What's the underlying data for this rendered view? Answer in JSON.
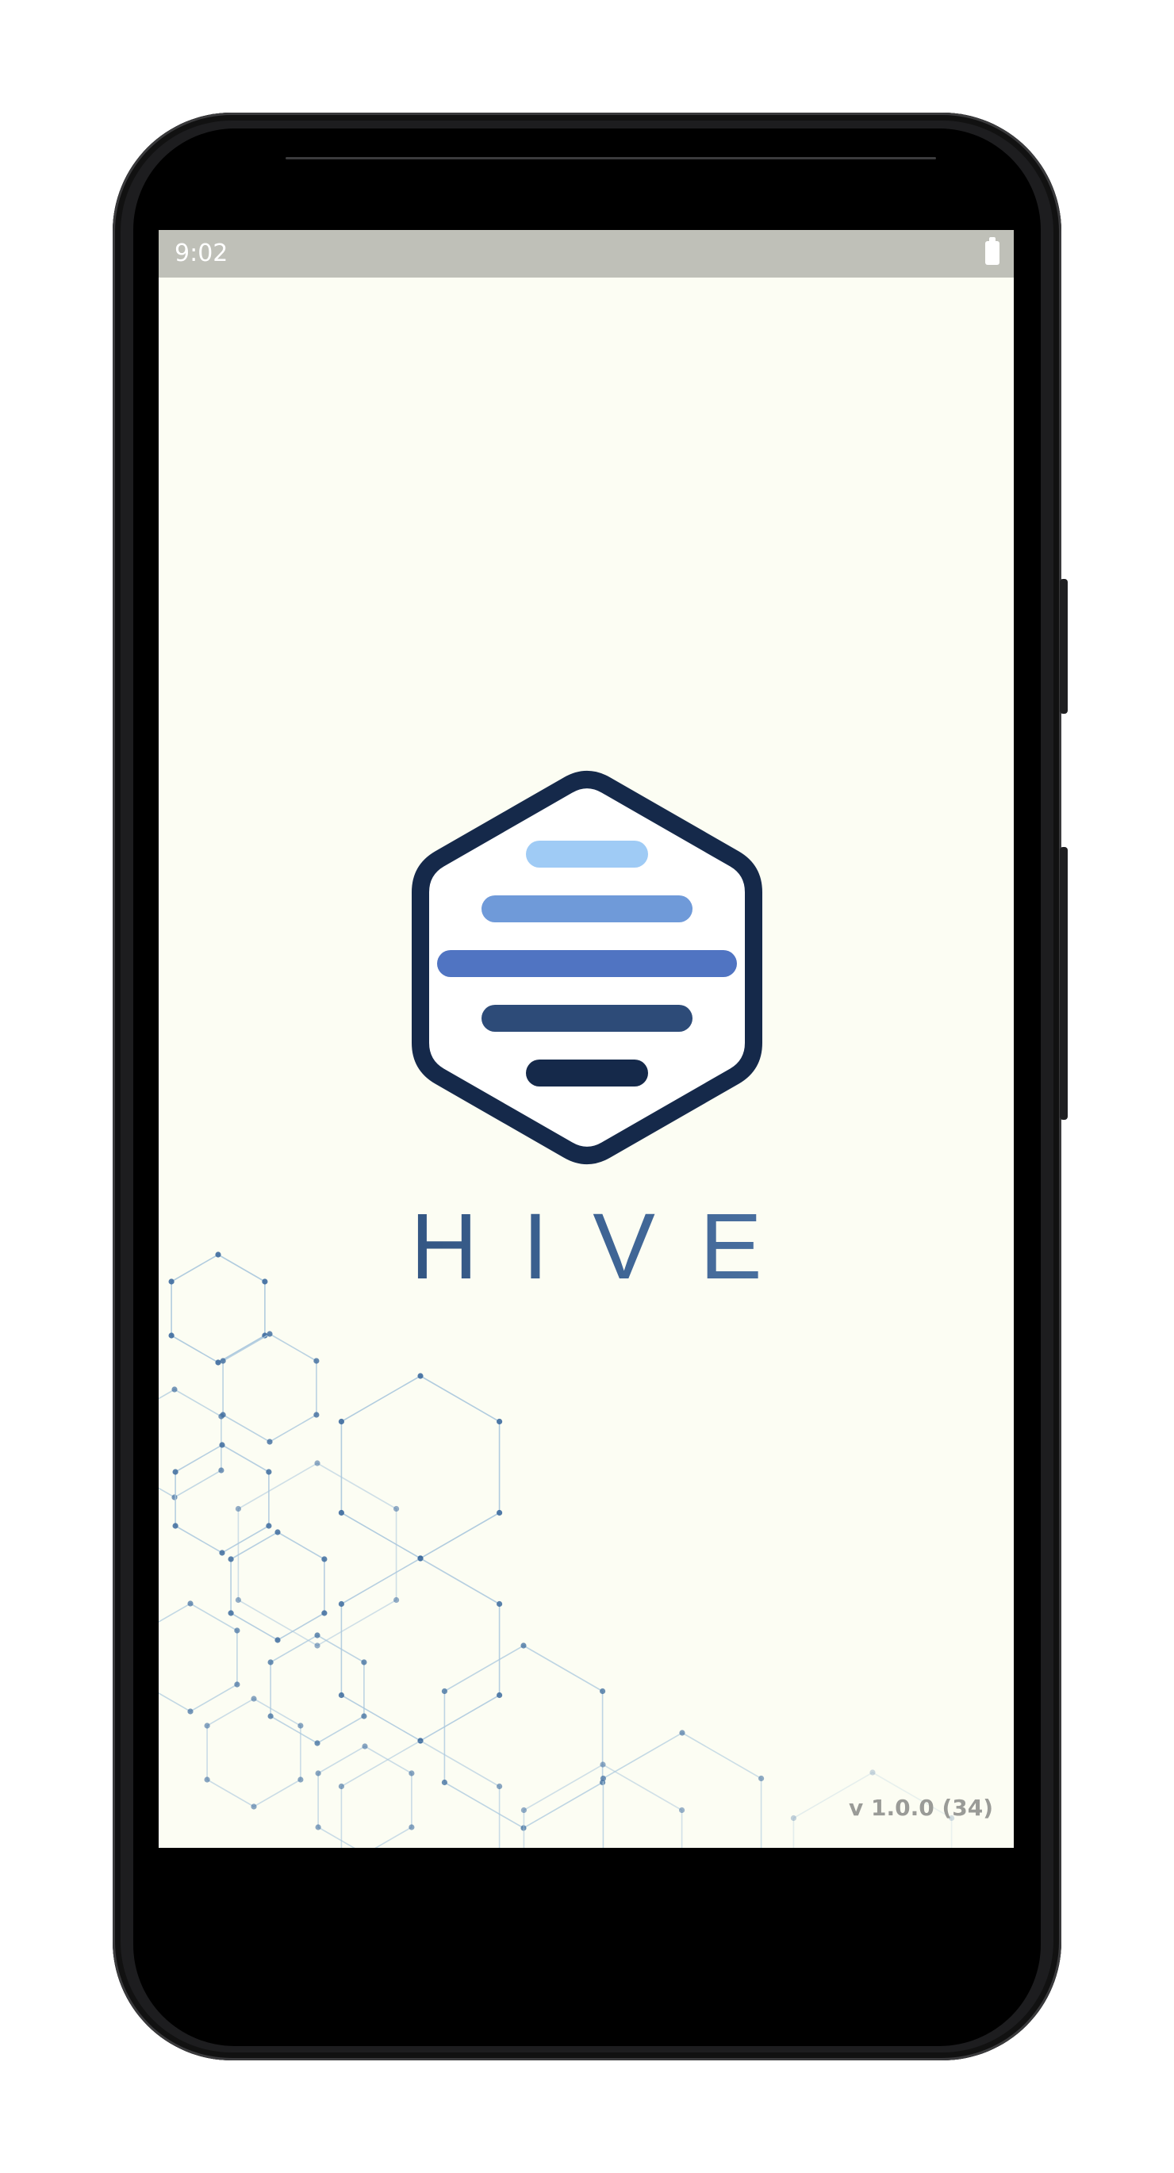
{
  "status_bar": {
    "time": "9:02",
    "battery_icon": "battery-full-icon"
  },
  "splash": {
    "brand": "HIVE",
    "version": "v 1.0.0 (34)",
    "logo_icon": "hive-hexagon-logo-icon",
    "background_pattern": "hexagon-network-pattern"
  },
  "colors": {
    "screen_background": "#fcfdf3",
    "status_bar": "#bfc0b8",
    "logo_outline": "#15294a",
    "bar_1": "#9fcbf5",
    "bar_2": "#6f9ad9",
    "bar_3": "#5074c2",
    "bar_4": "#2d4b78",
    "bar_5": "#15294a",
    "brand_text": "#2f5383",
    "version_text": "#9a9b97",
    "pattern_line": "#a9c7dd",
    "pattern_node": "#3e6c9e"
  }
}
